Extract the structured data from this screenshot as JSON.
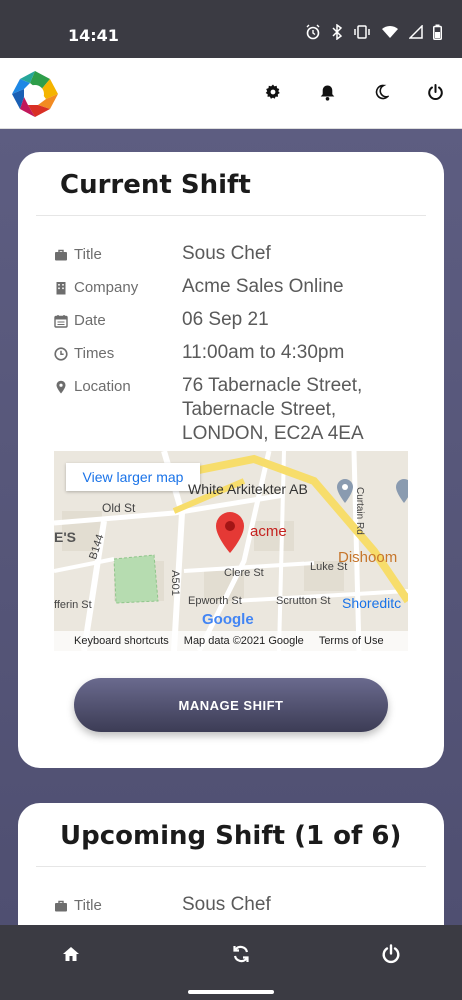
{
  "status_bar": {
    "time": "14:41"
  },
  "app_bar": {
    "icons": [
      "settings-icon",
      "bell-icon",
      "moon-icon",
      "power-icon"
    ]
  },
  "current_shift": {
    "heading": "Current Shift",
    "fields": [
      {
        "label": "Title",
        "icon": "briefcase-icon",
        "value": "Sous Chef"
      },
      {
        "label": "Company",
        "icon": "building-icon",
        "value": "Acme Sales Online"
      },
      {
        "label": "Date",
        "icon": "calendar-icon",
        "value": "06 Sep 21"
      },
      {
        "label": "Times",
        "icon": "clock-icon",
        "value": "11:00am to 4:30pm"
      },
      {
        "label": "Location",
        "icon": "map-marker-icon",
        "value": "76 Tabernacle Street, Tabernacle Street, LONDON, EC2A 4EA"
      }
    ],
    "map": {
      "larger_map_label": "View larger map",
      "marker_label": "acme",
      "place_labels": [
        "White Arkitekter AB",
        "Old St",
        "Dishoom",
        "Clere St",
        "Luke St",
        "Epworth St",
        "Scrutton St",
        "Shoreditc",
        "Curtain Rd",
        "B144",
        "A501",
        "E'S",
        "fferin St"
      ],
      "google_logo": "Google",
      "footer": [
        "Keyboard shortcuts",
        "Map data ©2021 Google",
        "Terms of Use"
      ]
    },
    "manage_button": "MANAGE SHIFT"
  },
  "upcoming_shift": {
    "heading": "Upcoming Shift (1 of 6)",
    "fields": [
      {
        "label": "Title",
        "icon": "briefcase-icon",
        "value": "Sous Chef"
      }
    ]
  },
  "colors": {
    "background": "#5e5e82",
    "button": "#4a4a68",
    "status_bar": "#3b3b43",
    "map_link": "#1a73e8",
    "marker": "#d93025"
  }
}
